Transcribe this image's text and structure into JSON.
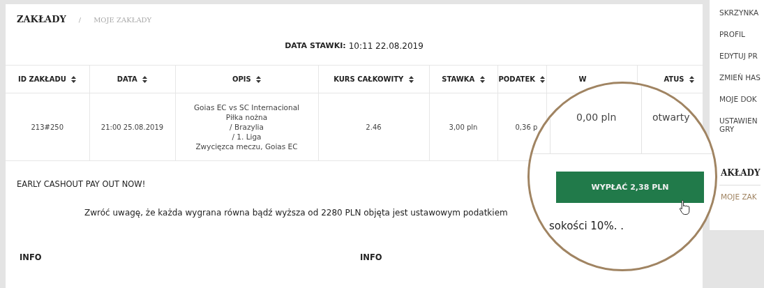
{
  "breadcrumb": [
    {
      "label": "ZAKŁADY",
      "selected": true
    },
    {
      "label": "MOJE ZAKŁADY",
      "selected": false
    }
  ],
  "separator": "/",
  "bet_date": {
    "label": "DATA STAWKI:",
    "value": "10:11 22.08.2019"
  },
  "table": {
    "columns": [
      {
        "label": "ID ZAKŁADU",
        "sortable": true
      },
      {
        "label": "DATA",
        "sortable": true
      },
      {
        "label": "OPIS",
        "sortable": true
      },
      {
        "label": "KURS CAŁKOWITY",
        "sortable": true
      },
      {
        "label": "STAWKA",
        "sortable": true
      },
      {
        "label": "PODATEK",
        "sortable": true
      },
      {
        "label": "W",
        "sortable": false
      },
      {
        "label": "ATUS",
        "sortable": true
      }
    ],
    "rows": [
      {
        "id": "213#250",
        "date": "21:00 25.08.2019",
        "description": [
          "Goias EC vs SC Internacional",
          "Piłka nożna",
          "/ Brazylia",
          "/ 1. Liga",
          "Zwycięzca meczu, Goias EC"
        ],
        "odds": "2.46",
        "stake": "3,00 pln",
        "tax": "0,36 p"
      }
    ]
  },
  "cashout_title": "EARLY CASHOUT PAY OUT NOW!",
  "notice": "Zwróć uwagę, że każda wygrana równa bądź wyższa od 2280 PLN objęta jest ustawowym podatkiem",
  "info_headings": [
    "INFO",
    "INFO"
  ],
  "magnifier": {
    "winnings": "0,00 pln",
    "status": "otwarty",
    "button": "WYPŁAĆ 2,38 PLN",
    "notice_tail": "sokości 10%. ."
  },
  "sidebar": {
    "items": [
      "SKRZYNKA",
      "PROFIL",
      "EDYTUJ PR",
      "ZMIEŃ HAS",
      "MOJE DOK",
      "USTAWIEN GRY"
    ],
    "section_title": "AKŁADY",
    "section_items": [
      "MOJE ZAK"
    ]
  }
}
